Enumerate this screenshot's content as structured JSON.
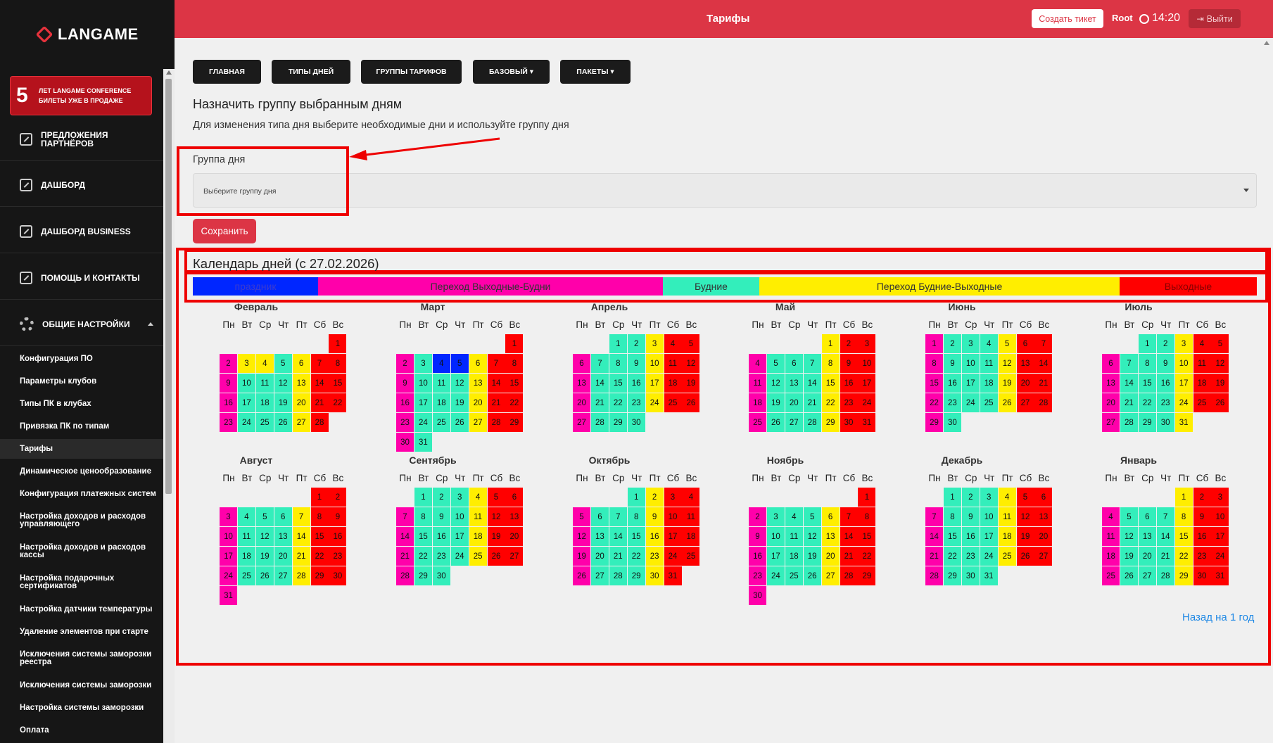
{
  "sidebar": {
    "logo": "LANGAME",
    "promo_number": "5",
    "promo_line1": "ЛЕТ LANGAME CONFERENCE",
    "promo_line2": "БИЛЕТЫ УЖЕ В ПРОДАЖЕ",
    "main_items": [
      {
        "label": "ПРЕДЛОЖЕНИЯ\nПАРТНЁРОВ"
      },
      {
        "label": "ДАШБОРД"
      },
      {
        "label": "ДАШБОРД BUSINESS"
      },
      {
        "label": "ПОМОЩЬ И КОНТАКТЫ"
      },
      {
        "label": "ОБЩИЕ НАСТРОЙКИ"
      }
    ],
    "sub_items": [
      {
        "label": "Конфигурация ПО"
      },
      {
        "label": "Параметры клубов"
      },
      {
        "label": "Типы ПК в клубах"
      },
      {
        "label": "Привязка ПК по типам"
      },
      {
        "label": "Тарифы"
      },
      {
        "label": "Динамическое ценообразование"
      },
      {
        "label": "Конфигурация платежных систем"
      },
      {
        "label": "Настройка доходов и расходов управляющего"
      },
      {
        "label": "Настройка доходов и расходов кассы"
      },
      {
        "label": "Настройка подарочных сертификатов"
      },
      {
        "label": "Настройка датчики температуры"
      },
      {
        "label": "Удаление элементов при старте"
      },
      {
        "label": "Исключения системы заморозки реестра"
      },
      {
        "label": "Исключения системы заморозки"
      },
      {
        "label": "Настройка системы заморозки"
      },
      {
        "label": "Оплата"
      }
    ]
  },
  "header": {
    "title": "Тарифы",
    "ticket_button": "Создать тикет",
    "user": "Root",
    "time": "14:20",
    "logout": "Выйти"
  },
  "tabs": [
    {
      "label": "ГЛАВНАЯ"
    },
    {
      "label": "ТИПЫ ДНЕЙ"
    },
    {
      "label": "ГРУППЫ ТАРИФОВ"
    },
    {
      "label": "БАЗОВЫЙ ▾"
    },
    {
      "label": "ПАКЕТЫ ▾"
    }
  ],
  "assign": {
    "title": "Назначить группу выбранным дням",
    "description": "Для изменения типа дня выберите необходимые дни и используйте группу дня",
    "group_label": "Группа дня",
    "select_placeholder": "Выберите группу дня",
    "save": "Сохранить"
  },
  "calendar": {
    "title": "Календарь дней (с 27.02.2026)",
    "weekdays": [
      "Пн",
      "Вт",
      "Ср",
      "Чт",
      "Пт",
      "Сб",
      "Вс"
    ],
    "back_link": "Назад на 1 год",
    "legend": [
      {
        "label": "праздник",
        "color": "#0026ff",
        "text_color": "#3b3bd0",
        "flex": 178
      },
      {
        "label": "Переход Выходные-Будни",
        "color": "#ff00aa",
        "text_color": "#333333",
        "flex": 490
      },
      {
        "label": "Будние",
        "color": "#33eebb",
        "text_color": "#333333",
        "flex": 137
      },
      {
        "label": "Переход Будние-Выходные",
        "color": "#ffee00",
        "text_color": "#333333",
        "flex": 512
      },
      {
        "label": "Выходные",
        "color": "#ff0000",
        "text_color": "#880000",
        "flex": 195
      }
    ],
    "colors": {
      "W": "#ff0000",
      "P": "#ff00aa",
      "G": "#33eebb",
      "Y": "#ffee00",
      "B": "#0026ff"
    },
    "months": [
      {
        "name": "Февраль",
        "offset": 6,
        "days": 28,
        "codes": "WPYYGYWWPGGGYWWPGGGYWWPGGGYW"
      },
      {
        "name": "Март",
        "offset": 6,
        "days": 31,
        "codes": "WPGBBYWWPGGGYWWPGGGYWWPGGGYWWPG"
      },
      {
        "name": "Апрель",
        "offset": 2,
        "days": 30,
        "codes": "GGYWWPGGGYWWPGGGYWWPGGGYWWPGGG"
      },
      {
        "name": "Май",
        "offset": 4,
        "days": 31,
        "codes": "YWWPGGGYWWPGGGYWWPGGGYWWPGGGYWW"
      },
      {
        "name": "Июнь",
        "offset": 0,
        "days": 30,
        "codes": "PGGGYWWPGGGYWWPGGGYWWPGGGYWWPG"
      },
      {
        "name": "Июль",
        "offset": 2,
        "days": 31,
        "codes": "GGYWWPGGGYWWPGGGYWWPGGGYWWPGGGY"
      },
      {
        "name": "Август",
        "offset": 5,
        "days": 31,
        "codes": "WWPGGGYWWPGGGYWWPGGGYWWPGGGYWWP"
      },
      {
        "name": "Сентябрь",
        "offset": 1,
        "days": 30,
        "codes": "GGGYWWPGGGYWWPGGGYWWPGGGYWWPGG"
      },
      {
        "name": "Октябрь",
        "offset": 3,
        "days": 31,
        "codes": "GYWWPGGGYWWPGGGYWWPGGGYWWPGGGYW"
      },
      {
        "name": "Ноябрь",
        "offset": 6,
        "days": 30,
        "codes": "WPGGGYWWPGGGYWWPGGGYWWPGGGYWWP"
      },
      {
        "name": "Декабрь",
        "offset": 1,
        "days": 31,
        "codes": "GGGYWWPGGGYWWPGGGYWWPGGGYWWPGGG"
      },
      {
        "name": "Январь",
        "offset": 4,
        "days": 31,
        "codes": "YWWPGGGYWWPGGGYWWPGGGYWWPGGGYWW"
      }
    ]
  }
}
